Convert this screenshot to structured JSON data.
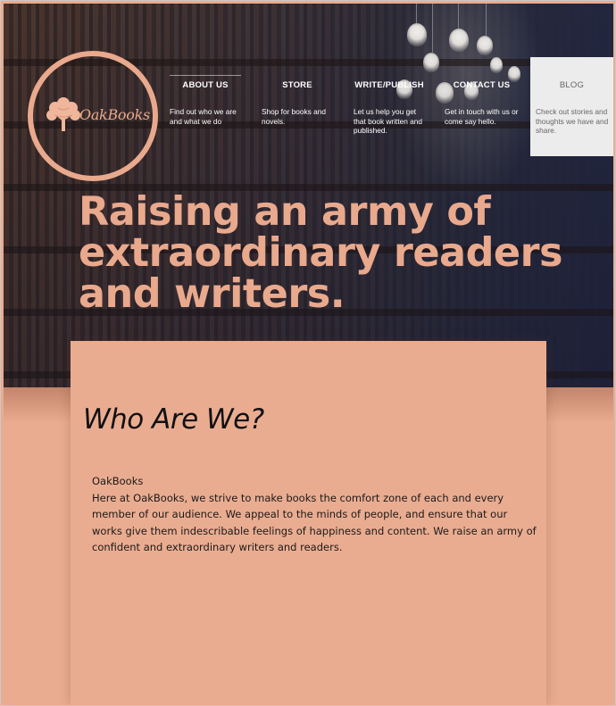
{
  "logo": {
    "text": "OakBooks",
    "icon": "tree-icon",
    "color": "#e9a98d"
  },
  "nav": [
    {
      "label": "ABOUT US",
      "desc": "Find out who we are and what we do",
      "active": true
    },
    {
      "label": "STORE",
      "desc": "Shop for books and novels."
    },
    {
      "label": "WRITE/PUBLISH",
      "desc": "Let us help you get that book written and published."
    },
    {
      "label": "CONTACT US",
      "desc": "Get in touch with us or come say hello."
    },
    {
      "label": "BLOG",
      "desc": "Check out stories and thoughts we have and share.",
      "hovered": true
    }
  ],
  "hero": {
    "headline": "Raising an army of extraordinary readers and writers."
  },
  "about": {
    "title": "Who Are We?",
    "subtitle": "OakBooks",
    "body": "Here at OakBooks, we strive to make books the comfort zone of each and every member of our audience. We appeal to the minds of people, and ensure that our works give them indescribable feelings of happiness and content. We raise an army of confident and extraordinary writers and readers."
  },
  "colors": {
    "accent": "#e9a98d",
    "background": "#eaac90",
    "hero_dark": "#262a3d",
    "blog_bg": "#ececec"
  }
}
